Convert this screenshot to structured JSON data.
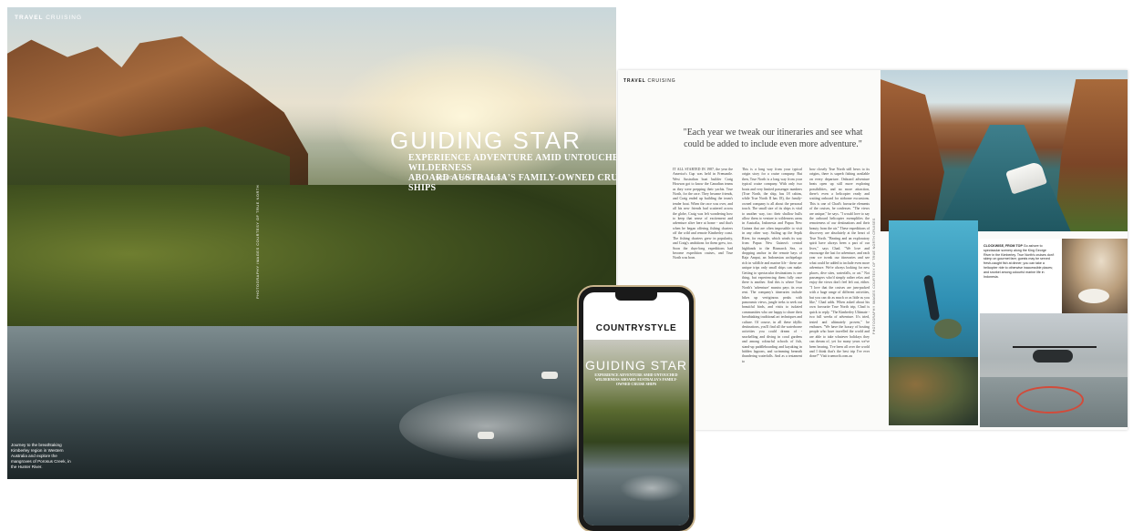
{
  "left_spread": {
    "kicker_section": "TRAVEL",
    "kicker_sub": "CRUISING",
    "title": "GUIDING STAR",
    "subtitle_line1": "EXPERIENCE ADVENTURE AMID UNTOUCHED WILDERNESS",
    "subtitle_line2": "ABOARD AUSTRALIA'S FAMILY-OWNED CRUISE SHIPS",
    "byline": "WORDS HANNAH JAMES",
    "photo_credit": "PHOTOGRAPHY IMAGES COURTESY OF TRUE NORTH",
    "caption": "Journey to the breathtaking Kimberley region in Western Australia and explore the mangroves of Porosus Creek, in the Hunter River."
  },
  "right_spread": {
    "kicker_section": "TRAVEL",
    "kicker_sub": "CRUISING",
    "pull_quote": "\"Each year we tweak our itineraries and see what could be added to include even more adventure.\"",
    "columns": [
      "IT ALL STARTED IN 1987, the year the America's Cup was held in Fremantle. West Australian boat builder Craig Howson got to know the Canadian teams as they were prepping their yachts. True North, for the race. They became friends, and Craig ended up building the team's tender boat. When the race was over, and all his new friends had scattered across the globe, Craig was left wondering how to keep that sense of excitement and adventure alive here at home - and that's when he began offering fishing charters off the wild and remote Kimberley coast. The fishing charters grew in popularity, and Craig's ambitions for them grew, too. Soon the days-long expeditions had become expedition cruises, and True North was born.",
      "This is a long way from your typical origin story for a cruise company. But then, True North is a long way from your typical cruise company. With only two boats and very limited passenger numbers (True North, the ship, has 18 cabins, while True North II has 18), the family-owned company is all about the personal touch. The small size of its ships is vital to another way, too: their shallow hulls allow them to venture to wilderness areas in Australia, Indonesia and Papua New Guinea that are often impossible to visit in any other way. Sailing up the Sepik River, for example, which winds its way from Papua New Guinea's central highlands to the Bismarck Sea, or dropping anchor in the remote bays of Raja Ampat, an Indonesian archipelago rich in wildlife and marine life - these are unique trips only small ships can make. Getting to spectacular destinations is one thing, but experiencing them fully once there is another. And this is where True North's 'adventure' mantra pays its own rent. The company's itineraries include hikes up vertiginous peaks with panoramic views, jungle treks to seek out beautiful birds, and visits to isolated communities who are happy to share their breathtaking traditional art techniques and culture. Of course, in all these idyllic destinations, you'll find all the waterborne activities you could dream of - snorkelling and diving in coral gardens and among colourful schools of fish, stand-up paddleboarding and kayaking in hidden lagoons, and swimming beneath thundering waterfalls. And as a testament to",
      "how closely True North still hews to its origins, there is superb fishing available on every departure. Onboard adventure beats open up still more exploring possibilities, and no more attraction, there's even a helicopter ready and waiting onboard for airborne excursions. This is one of Chad's favourite elements of the cruises, he confesses. \"The views are unique,\" he says. \"I would love to say the onboard helicopter exemplifies the remoteness of our destinations and their beauty from the air.\" These expeditions of discovery are absolutely at the heart of True North. \"Beating and an exploratory spirit have always been a part of our lives,\" says Chad. \"We love and encourage the lust for adventure, and each year we tweak our itineraries and see what could be added to include even more adventure. We're always looking for new places, dive sites, waterfalls, or art.\" Not passengers who'd simply rather relax and enjoy the views don't feel left out, either. \"I love that the cruises are jam-packed with a huge range of different activities, but you can do as much or as little as you like,\" Chad adds. When asked about his own favourite True North trip, Chad is quick to reply. \"The Kimberley Ultimate - two full weeks of adventure. It's tried, tested and ultimately proven,\" he enthuses. \"We have the luxury of hosting people who have travelled the world and are able to take whatever holidays they can dream of, yet for many years we've been hearing, 'I've been all over the world and I think that's the best trip I've ever done!'\" Visit truenorth.com.au"
    ],
    "photo_credit": "PHOTOGRAPHY IMAGES COURTESY OF TRUE NORTH CRUISES",
    "caption_lead": "CLOCKWISE, FROM TOP",
    "caption_text": "Go ashore to spectacular scenery along the King George River in the Kimberley. True North's cruises don't skimp on gourmet fare; guests may be served fresh-caught fish at dinner; you can take a helicopter ride to otherwise inaccessible places; and snorkel among colourful marine life in Indonesia."
  },
  "phone": {
    "masthead": "COUNTRYSTYLE",
    "title": "GUIDING STAR",
    "subtitle": "EXPERIENCE ADVENTURE AMID UNTOUCHED WILDERNESS ABOARD AUSTRALIA'S FAMILY-OWNED CRUISE SHIPS"
  }
}
